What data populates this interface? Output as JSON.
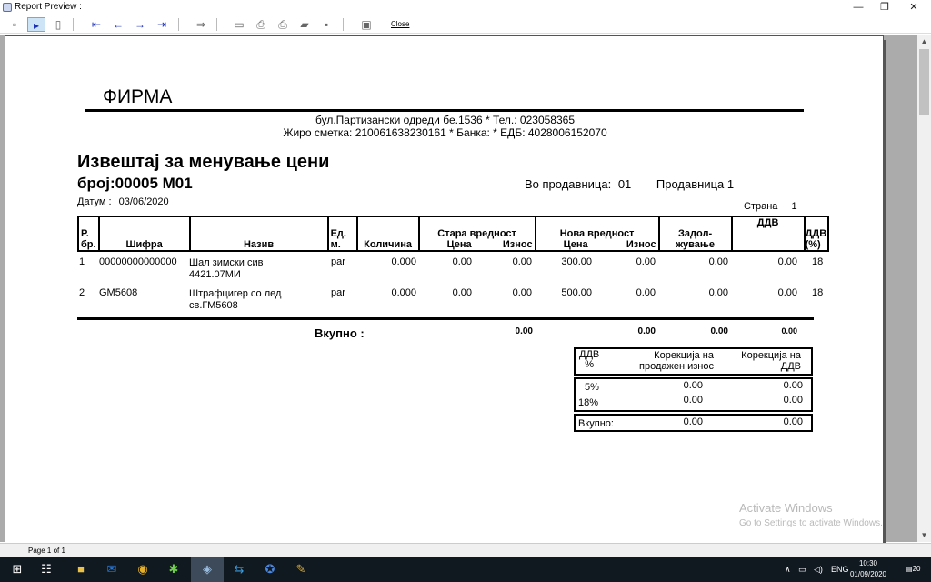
{
  "window": {
    "title": "Report Preview :",
    "minimize": "—",
    "restore": "❐",
    "close": "✕"
  },
  "toolbar": {
    "close_label": "Close"
  },
  "status": {
    "page": "Page 1 of 1"
  },
  "report": {
    "company": "ФИРМА",
    "address_line1": "бул.Партизански одреди бе.1536 * Тел.: 023058365",
    "address_line2": "Жиро сметка: 210061638230161 * Банка:   * ЕДБ: 4028006152070",
    "title": "Извештај за менување цени",
    "number": "број:00005  М01",
    "store_label": "Во продавница:",
    "store_code": "01",
    "store_name": "Продавница 1",
    "date_label": "Датум :",
    "date_value": "03/06/2020",
    "page_label": "Страна",
    "page_value": "1",
    "columns": {
      "rbr_top": "Р.",
      "rbr_bottom": "бр.",
      "sifra": "Шифра",
      "naziv": "Назив",
      "edm_top": "Ед.",
      "edm_bottom": "м.",
      "kolicina": "Количина",
      "stara": "Стара вредност",
      "stara_cena": "Цена",
      "stara_iznos": "Износ",
      "nova": "Нова вредност",
      "nova_cena": "Цена",
      "nova_iznos": "Износ",
      "zadol_top": "Задол-",
      "zadol_bottom": "жување",
      "ddv": "ДДВ",
      "ddvp_top": "ДДВ",
      "ddvp_bottom": "(%)"
    },
    "rows": [
      {
        "rbr": "1",
        "sifra": "00000000000000",
        "naziv1": "Шал зимски сив",
        "naziv2": "4421.07МИ",
        "edm": "par",
        "kolicina": "0.000",
        "stara_cena": "0.00",
        "stara_iznos": "0.00",
        "nova_cena": "300.00",
        "nova_iznos": "0.00",
        "zadol": "0.00",
        "ddv": "0.00",
        "ddvp": "18"
      },
      {
        "rbr": "2",
        "sifra": "GM5608",
        "naziv1": "Штрафцигер со лед",
        "naziv2": "св.ГМ5608",
        "edm": "par",
        "kolicina": "0.000",
        "stara_cena": "0.00",
        "stara_iznos": "0.00",
        "nova_cena": "500.00",
        "nova_iznos": "0.00",
        "zadol": "0.00",
        "ddv": "0.00",
        "ddvp": "18"
      }
    ],
    "totals": {
      "label": "Вкупно :",
      "stara_iznos": "0.00",
      "nova_iznos": "0.00",
      "zadol": "0.00",
      "ddv": "0.00"
    },
    "vat_summary": {
      "h_rate_top": "ДДВ",
      "h_rate_bottom": "%",
      "h_corr_sale": "Корекција на продажен износ",
      "h_corr_vat": "Корекција на ДДВ",
      "rows": [
        {
          "rate": "5%",
          "sale": "0.00",
          "vat": "0.00"
        },
        {
          "rate": "18%",
          "sale": "0.00",
          "vat": "0.00"
        }
      ],
      "total_label": "Вкупно:",
      "total_sale": "0.00",
      "total_vat": "0.00"
    }
  },
  "watermark": {
    "line1": "Activate Windows",
    "line2": "Go to Settings to activate Windows."
  },
  "taskbar": {
    "lang": "ENG",
    "time": "10:30",
    "date": "01/09/2020",
    "notifications": "20"
  }
}
